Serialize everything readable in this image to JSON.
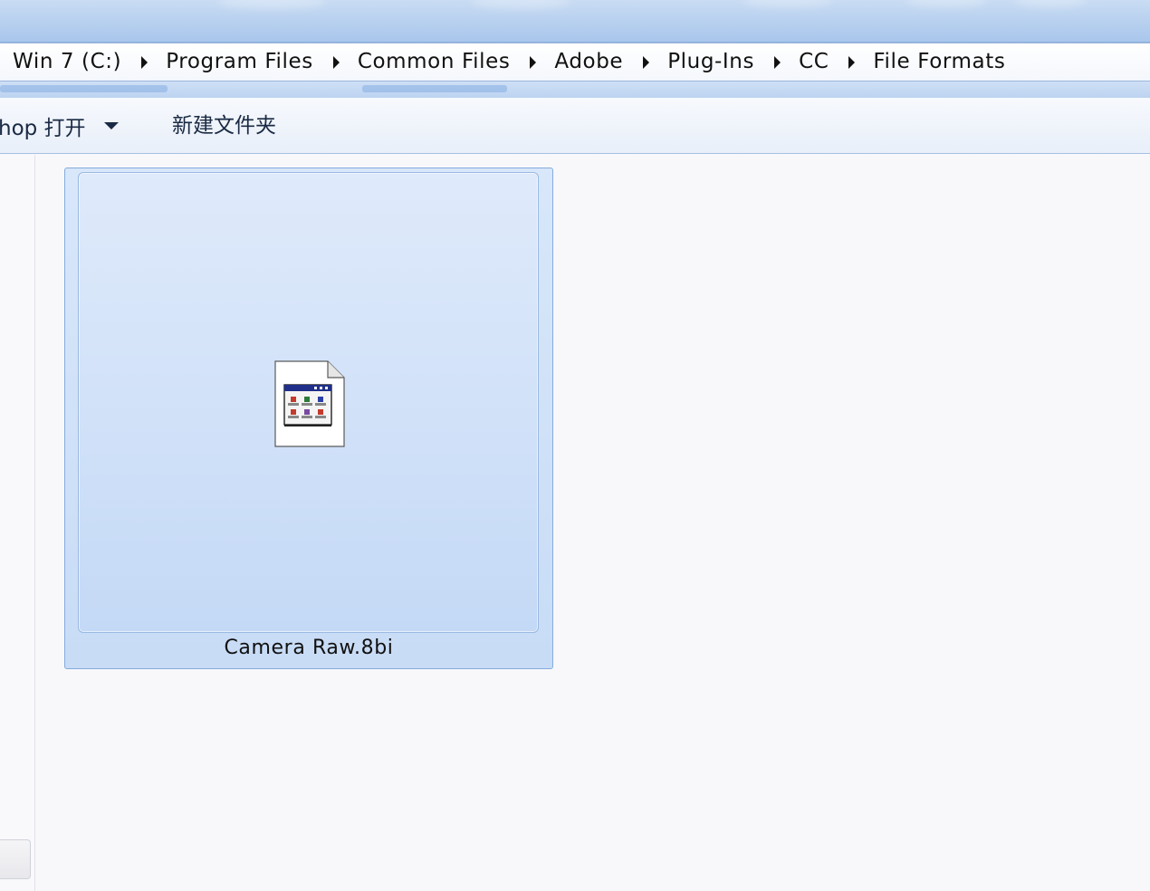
{
  "breadcrumb": {
    "items": [
      "Win 7 (C:)",
      "Program Files",
      "Common Files",
      "Adobe",
      "Plug-Ins",
      "CC",
      "File Formats"
    ]
  },
  "toolbar": {
    "open_with_label": "hop 打开",
    "new_folder_label": "新建文件夹"
  },
  "files": [
    {
      "name": "Camera Raw.8bi",
      "icon": "plugin-file-icon",
      "selected": true
    }
  ],
  "colors": {
    "selection_fill": "#cce0f7",
    "selection_border": "#84acdd",
    "toolbar_text": "#1a2a44"
  }
}
